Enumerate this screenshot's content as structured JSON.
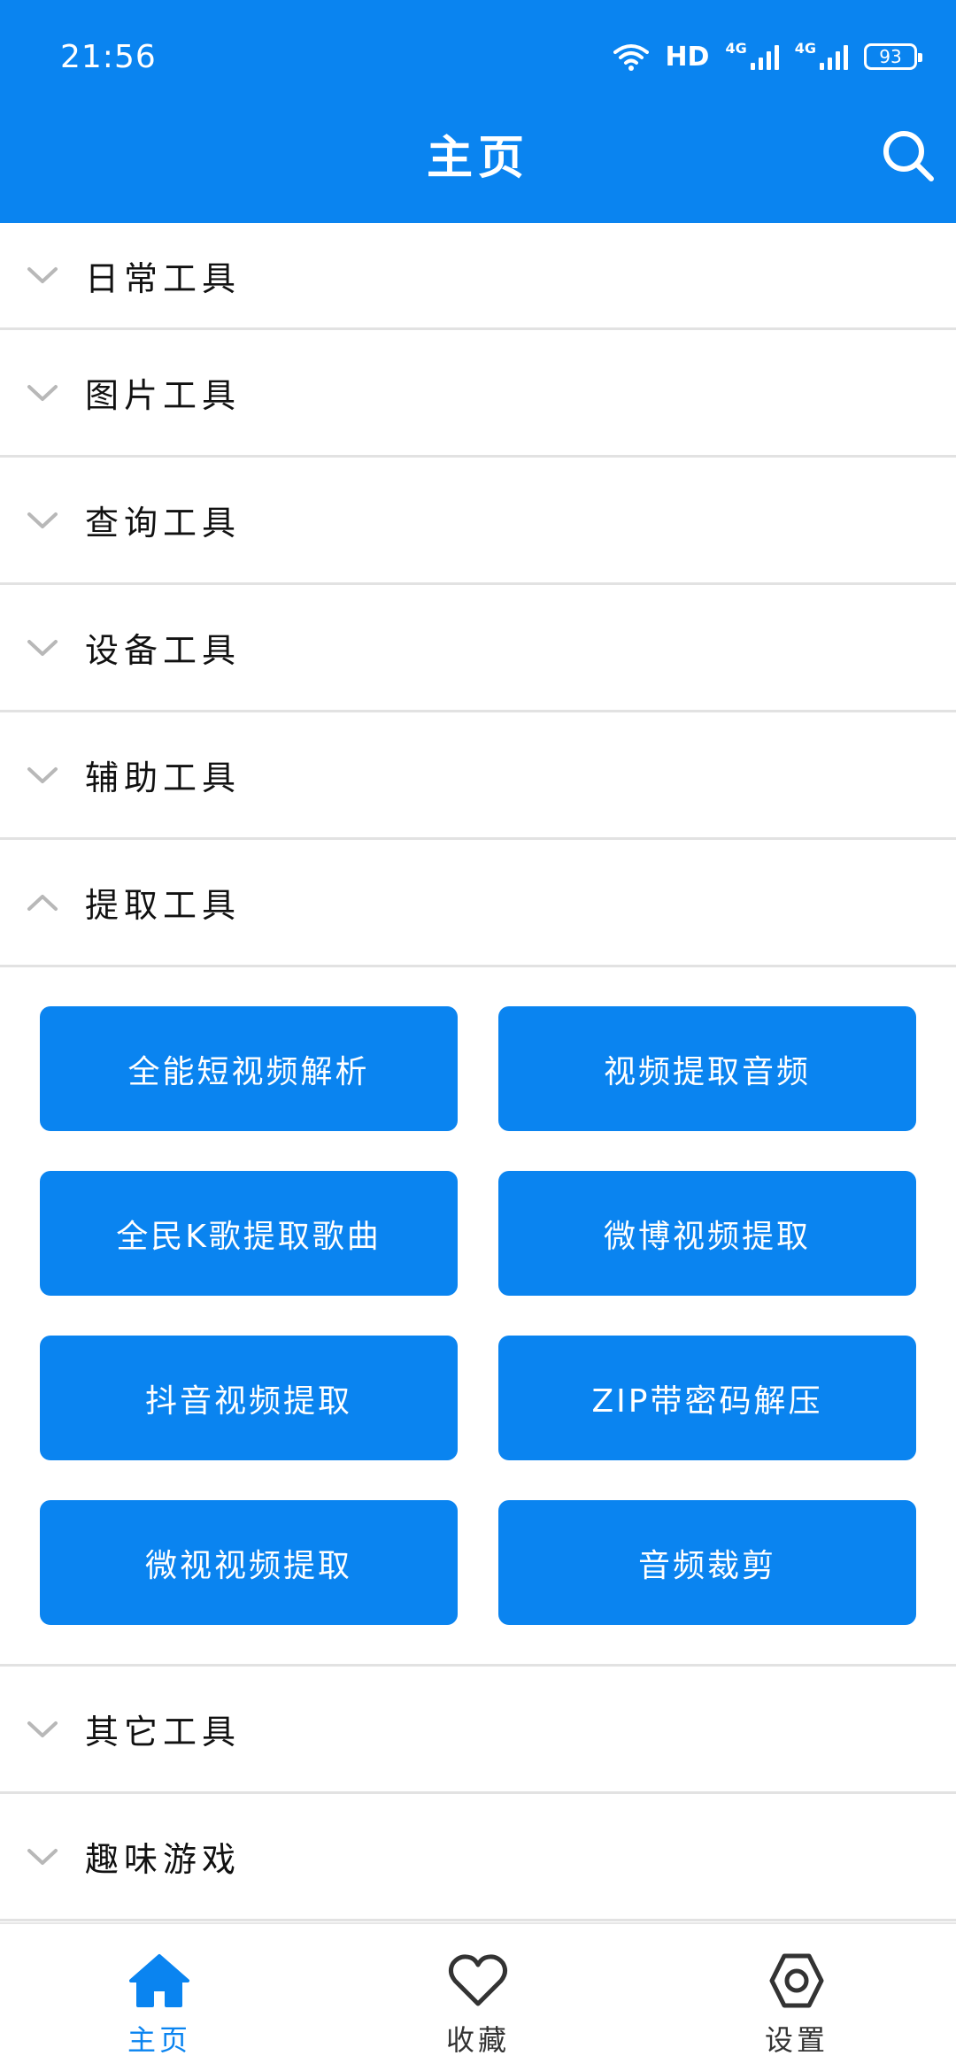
{
  "status_bar": {
    "time": "21:56",
    "hd": "HD",
    "net1": "4G",
    "net2": "4G",
    "battery": "93"
  },
  "header": {
    "title": "主页"
  },
  "categories_top": [
    {
      "label": "日常工具",
      "expanded": false
    },
    {
      "label": "图片工具",
      "expanded": false
    },
    {
      "label": "查询工具",
      "expanded": false
    },
    {
      "label": "设备工具",
      "expanded": false
    },
    {
      "label": "辅助工具",
      "expanded": false
    },
    {
      "label": "提取工具",
      "expanded": true
    }
  ],
  "tools": [
    "全能短视频解析",
    "视频提取音频",
    "全民K歌提取歌曲",
    "微博视频提取",
    "抖音视频提取",
    "ZIP带密码解压",
    "微视视频提取",
    "音频裁剪"
  ],
  "categories_bottom": [
    {
      "label": "其它工具",
      "expanded": false
    },
    {
      "label": "趣味游戏",
      "expanded": false
    }
  ],
  "bottom_nav": [
    {
      "label": "主页",
      "icon": "home-icon",
      "active": true
    },
    {
      "label": "收藏",
      "icon": "heart-icon",
      "active": false
    },
    {
      "label": "设置",
      "icon": "settings-icon",
      "active": false
    }
  ],
  "colors": {
    "primary": "#0a84f0",
    "divider": "#e2e2e2",
    "chevron": "#b8b8b8"
  }
}
